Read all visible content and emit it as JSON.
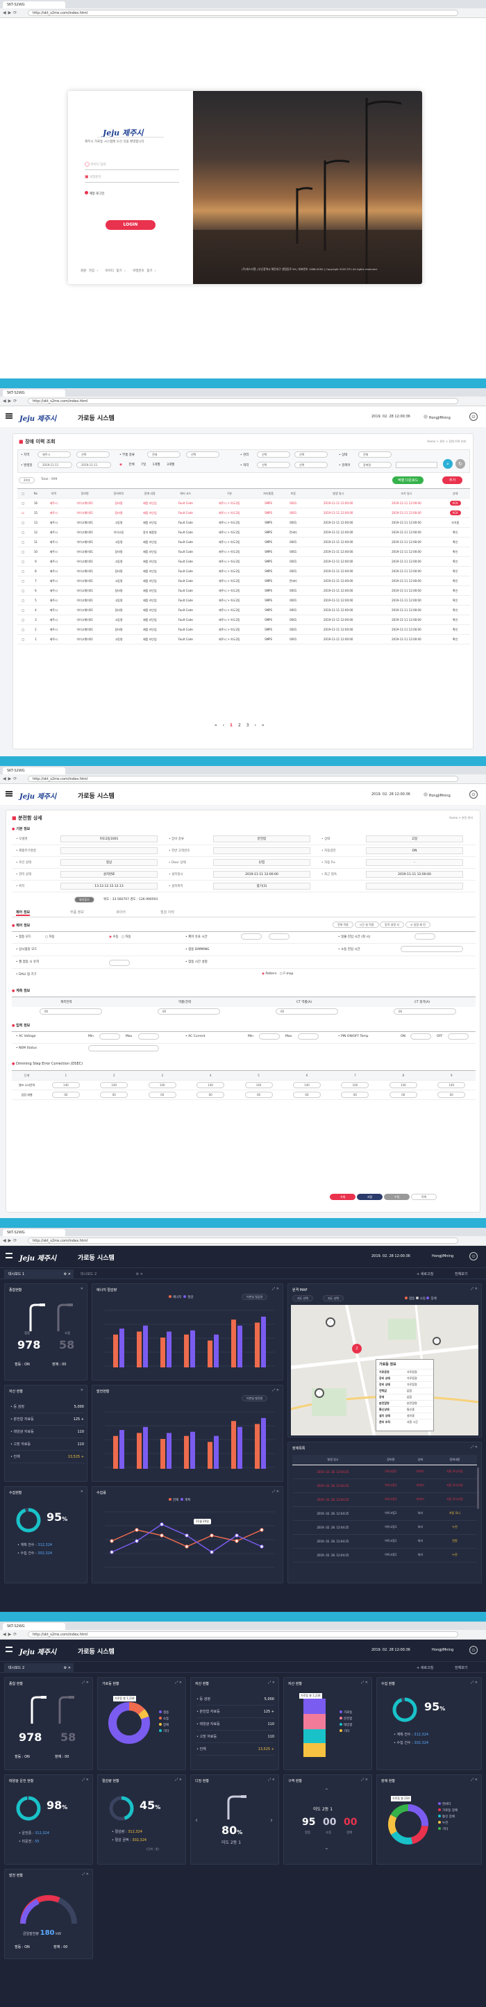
{
  "browser": {
    "tab_title": "SKT-S2WG",
    "url": "http://skt_s2ms.com/index.html"
  },
  "login": {
    "logo_text": "제주시",
    "welcome": "제주시 가로등 시스템에 오신 것을 환영합니다",
    "id_placeholder": "아이디 입력",
    "pw_placeholder": "비밀번호",
    "remember": "계정 로그인",
    "login_button": "LOGIN",
    "links": [
      "회원 가입 ›",
      "아이디 찾기 ›",
      "비밀번호 찾기 ›"
    ],
    "copyright": "(주)에스티엘 | 부산광역시 해운대구 센텀동로 99 | 대표번호 1588-0000 | Copyright 2020 STL All rights reserved."
  },
  "header": {
    "logo_text": "제주시",
    "system_name": "가로등 시스템",
    "datetime": "2019. 02. 28  12:00:36",
    "user": "HongjiMning"
  },
  "history": {
    "title": "장애 이력 조회",
    "breadcrumb": "Home  >  관리  >  장애 이력 조회",
    "filters": {
      "f1": "• 지역",
      "f1v": "제주시",
      "f2v": "선택",
      "f3": "• 부품 종류",
      "f3v": "전체",
      "f4": "• 관리",
      "f4v": "선택",
      "f5": "• 상태",
      "f5v": "전체",
      "f6": "• 발생일",
      "date1": "2019-11-11",
      "date2": "2019-11-11",
      "period": [
        "전체",
        "7일",
        "1개월",
        "3개월"
      ],
      "f7": "• 처리",
      "f7v": "선택",
      "f8": "• 검색어",
      "f8v": "장애명"
    },
    "total": "Total : 999",
    "view_label": "20개",
    "excel_button": "엑셀 다운로드",
    "add_button": "추가",
    "columns": [
      "No",
      "지역",
      "장비명",
      "장비위치",
      "장애 내용",
      "에러 코드",
      "구분",
      "처리물품",
      "보증",
      "발생 일시",
      "조치 일시",
      "상태"
    ],
    "rows": [
      [
        "16",
        "제주시",
        "아이고웨이01",
        "장비명",
        "제품 라인업",
        "Fault Code",
        "제주시 > 아도2동",
        "SMPS",
        "0001",
        "2019-11-11 12:00:00",
        "2019-11-11 12:00:00",
        "ACK"
      ],
      [
        "15",
        "제주시",
        "아이고웨이01",
        "장비명",
        "제품 라인업",
        "Fault Code",
        "제주시 > 아도2동",
        "SMPS",
        "0001",
        "2019-11-11 12:00:00",
        "2019-11-11 12:00:00",
        "ACK"
      ],
      [
        "13",
        "제주시",
        "아이고웨이01",
        "고등명",
        "제품 라인업",
        "Fault Code",
        "제주시 > 아도2동",
        "SMPS",
        "0001",
        "2019-11-11 12:00:00",
        "2019-11-11 12:00:00",
        "조치중"
      ],
      [
        "12",
        "제주시",
        "아이고웨이01",
        "아이고등",
        "장지 제품명",
        "Fault Code",
        "제주시 > 아도2동",
        "SMPS",
        "컨버터",
        "2019-11-11 12:00:00",
        "2019-11-11 12:00:00",
        "확인"
      ],
      [
        "11",
        "제주시",
        "아이고웨이01",
        "고등명",
        "제품 라인업",
        "Fault Code",
        "제주시 > 아도2동",
        "SMPS",
        "0001",
        "2019-11-11 12:00:00",
        "2019-11-11 12:00:00",
        "확인"
      ],
      [
        "10",
        "제주시",
        "아이고웨이01",
        "장비명",
        "제품 라인업",
        "Fault Code",
        "제주시 > 아도2동",
        "SMPS",
        "0001",
        "2019-11-11 12:00:00",
        "2019-11-11 12:00:00",
        "확인"
      ],
      [
        "9",
        "제주시",
        "아이고웨이01",
        "고등명",
        "제품 라인업",
        "Fault Code",
        "제주시 > 아도2동",
        "SMPS",
        "0001",
        "2019-11-11 12:00:00",
        "2019-11-11 12:00:00",
        "확인"
      ],
      [
        "8",
        "제주시",
        "아이고웨이01",
        "장비명",
        "제품 라인업",
        "Fault Code",
        "제주시 > 아도2동",
        "SMPS",
        "0001",
        "2019-11-11 12:00:00",
        "2019-11-11 12:00:00",
        "확인"
      ],
      [
        "7",
        "제주시",
        "아이고웨이01",
        "고등명",
        "제품 라인업",
        "Fault Code",
        "제주시 > 아도2동",
        "SMPS",
        "컨버터",
        "2019-11-11 12:00:00",
        "2019-11-11 12:00:00",
        "확인"
      ],
      [
        "6",
        "제주시",
        "아이고웨이01",
        "장비명",
        "제품 라인업",
        "Fault Code",
        "제주시 > 아도2동",
        "SMPS",
        "0001",
        "2019-11-11 12:00:00",
        "2019-11-11 12:00:00",
        "확인"
      ],
      [
        "5",
        "제주시",
        "아이고웨이01",
        "고등명",
        "제품 라인업",
        "Fault Code",
        "제주시 > 아도2동",
        "SMPS",
        "0001",
        "2019-11-11 12:00:00",
        "2019-11-11 12:00:00",
        "확인"
      ],
      [
        "4",
        "제주시",
        "아이고웨이01",
        "장비명",
        "제품 라인업",
        "Fault Code",
        "제주시 > 아도2동",
        "SMPS",
        "0001",
        "2019-11-11 12:00:00",
        "2019-11-11 12:00:00",
        "확인"
      ],
      [
        "3",
        "제주시",
        "아이고웨이01",
        "고등명",
        "제품 라인업",
        "Fault Code",
        "제주시 > 아도2동",
        "SMPS",
        "0001",
        "2019-11-11 12:00:00",
        "2019-11-11 12:00:00",
        "확인"
      ],
      [
        "2",
        "제주시",
        "아이고웨이01",
        "장비명",
        "제품 라인업",
        "Fault Code",
        "제주시 > 아도2동",
        "SMPS",
        "0001",
        "2019-11-11 12:00:00",
        "2019-11-11 12:00:00",
        "확인"
      ],
      [
        "1",
        "제주시",
        "아이고웨이01",
        "고등명",
        "제품 라인업",
        "Fault Code",
        "제주시 > 아도2동",
        "SMPS",
        "0001",
        "2019-11-11 12:00:00",
        "2019-11-11 12:00:00",
        "확인"
      ]
    ],
    "pagination": [
      "«",
      "‹",
      "1",
      "2",
      "3",
      "›",
      "»"
    ]
  },
  "detail": {
    "title": "분전함 상세",
    "breadcrumb": "Home  >  분전 관리",
    "s1": "기본 정보",
    "rows": [
      [
        "• 모델명",
        "이도2동1001",
        "• 장비 종류",
        "분전함",
        "• 상태",
        "고장"
      ],
      [
        "• 제품주기명칭",
        "",
        "• 전반 고객번호",
        "",
        "• 자동검진",
        "ON"
      ],
      [
        "• 조인 상태",
        "정상",
        "• Door 상태",
        "닫힘",
        "• 자동 Fix",
        "-"
      ],
      [
        "• 관리 상태",
        "설치완료",
        "• 설치일시",
        "2019-11-11 12:00:00",
        "• 최근 접속",
        "2019-11-11 12:00:00"
      ],
      [
        "• 위치",
        "13.12.12.12.12.13",
        "• 설치위치",
        "찾기(3)",
        "",
        ""
      ]
    ],
    "search_btn": "위치찾기",
    "coords": "위도 : 33.560707   경도 : 126.990593",
    "tabs": [
      "제어 정보",
      "부품 정보",
      "세이어",
      "점검 이력"
    ],
    "s2": "제어 정보",
    "ctrl_btns": [
      "전체 적용",
      "시간 설 적용",
      "동작 설정 지 ",
      "시 일정 제 된"
    ],
    "ctrl_labels": [
      "• 점등 모드",
      "• 제어 유효 시간",
      "• 상시점등 모드",
      "• 일몰 진입 시간 (최 시)",
      "• 월 점등 시 유지",
      "• 점등 DIMMING",
      "• DALI 점 기구",
      "• 점등 시간 설정",
      "• 소등 진입 시간"
    ],
    "mode_auto": "자동",
    "mode_manual": "수동",
    "pattern": "Pattern",
    "fmap": "F-map",
    "s3": "계측 정보",
    "meas_headers": [
      "계측전력",
      "역률(전력",
      "CT 역률(A)",
      "CT 정격(A)"
    ],
    "meas_vals": [
      "00",
      "00",
      "00",
      "00"
    ],
    "s4": "입력 정보",
    "input_labels": [
      "• AC Voltage",
      "Min",
      "Max",
      "• AC Current",
      "Min",
      "Max",
      "• PIN ON/OFF Temp",
      "ON",
      "OFF"
    ],
    "s4b": "• NEM Status",
    "dimming_title": "Dimming Step Error Correction (DSEC)",
    "dim_cols": [
      "단계",
      "1",
      "2",
      "3",
      "4",
      "5",
      "6",
      "7",
      "8",
      "9"
    ],
    "dim_rows": [
      [
        "램프 소비전력",
        "140",
        "140",
        "140",
        "140",
        "140",
        "140",
        "140",
        "140",
        "140"
      ],
      [
        "검정 레벨",
        "00",
        "00",
        "00",
        "00",
        "00",
        "00",
        "00",
        "00",
        "00"
      ]
    ],
    "buttons": [
      "삭제",
      "저장",
      "수정",
      "목록"
    ]
  },
  "dash1": {
    "tabs": [
      "대시보드 1",
      "대시보드 2"
    ],
    "new_tab": "+ 새로고침",
    "full": "전체보기",
    "p_total": {
      "title": "종합현황",
      "on": "점등",
      "off": "소등",
      "on_val": "978",
      "off_val": "58",
      "on_status": "점등 : ON",
      "off_status": "장애 : 00"
    },
    "p_energy": {
      "title": "에너지 절감량",
      "legend1": "에너지",
      "legend2": "절감",
      "sel": "이번달 절감량"
    },
    "p_map": {
      "title": "원격 MAP",
      "sel1": "지도 선택",
      "sel2": "지도 선택",
      "legend": [
        "점등",
        "소등",
        "장애"
      ],
      "popup_title": "가로등 정보",
      "popup_rows": [
        [
          "가로등명",
          "가로등명"
        ],
        [
          "장비 상태",
          "가로등명"
        ],
        [
          "장비 상태",
          "가로등명"
        ],
        [
          "전력값",
          "없음"
        ],
        [
          "장애",
          "없음"
        ],
        [
          "분전함명",
          "분전함명"
        ],
        [
          "통신상태",
          "통신중"
        ],
        [
          "설치 상태",
          "설치중"
        ],
        [
          "관리 조직",
          "사용 시간"
        ]
      ]
    },
    "p_asset": {
      "title": "자산 현황",
      "rows": [
        [
          "• 등 검정",
          "5,000",
          ""
        ],
        [
          "• 분전함 자료등",
          "125",
          "+"
        ],
        [
          "• 태양광 자료등",
          "110",
          ""
        ],
        [
          "• 고장 자료등",
          "110",
          ""
        ],
        [
          "• 전체",
          "13,525",
          "+"
        ]
      ]
    },
    "p_power": {
      "title": "발전현황",
      "sel": "이번달 발전량"
    },
    "p_wt": {
      "title": "수집현황",
      "pct": "95",
      "sub": "%",
      "r1l": "• 계획 전수 :",
      "r1v": "312,324",
      "r2l": "• 수집 건수 :",
      "r2v": "302,324"
    },
    "p_line": {
      "title": "수집률",
      "legend1": "현재",
      "legend2": "계획",
      "tip": "11월 20일"
    },
    "p_fault": {
      "title": "장애목록",
      "cols": [
        "발생 일시",
        "장비명",
        "상태",
        "장애내용"
      ],
      "rows": [
        [
          "2019. 02. 28. 12:04:25",
          "아이고등1",
          "미처리",
          "자동 모니터링"
        ],
        [
          "2019. 02. 28. 12:04:25",
          "아이고등1",
          "미처리",
          "자동 모니터링"
        ],
        [
          "2019. 02. 28. 12:04:25",
          "아이고등1",
          "미처리",
          "자동 모니터링"
        ],
        [
          "2019. 02. 28. 12:04:25",
          "아이고등1",
          "처리",
          "자동 모니"
        ],
        [
          "2019. 02. 28. 12:04:25",
          "아이고등1",
          "처리",
          "누전"
        ],
        [
          "2019. 02. 28. 12:04:25",
          "아이고등1",
          "처리",
          "전원"
        ],
        [
          "2019. 02. 28. 12:04:25",
          "아이고등1",
          "처리",
          "누전"
        ]
      ]
    }
  },
  "dash2": {
    "p_total": {
      "title": "종합 현황",
      "on_val": "978",
      "off_val": "58",
      "on_status": "점등 : ON",
      "off_status": "장애 : 00"
    },
    "p_lamp": {
      "title": "가로등 현황",
      "center": "가로등 총 1,234",
      "legend": [
        "점등",
        "소등",
        "장애",
        "기타"
      ]
    },
    "p_asset": {
      "title": "자산 현황",
      "rows": [
        [
          "• 등 검정",
          "5,000",
          ""
        ],
        [
          "• 분전함 자료등",
          "125",
          "+"
        ],
        [
          "• 태양광 자료등",
          "110",
          ""
        ],
        [
          "• 고장 자료등",
          "110",
          ""
        ],
        [
          "• 전체",
          "13,525",
          "+"
        ]
      ]
    },
    "p_asset2": {
      "title": "자산 현황",
      "center": "가로등 총 1,234",
      "legend": [
        "가로등",
        "분전함",
        "태양광",
        "기타"
      ]
    },
    "p_collect": {
      "title": "수집 현황",
      "pct": "95",
      "r1l": "• 계획 전수 :",
      "r1v": "312,324",
      "r2l": "• 수집 건수 :",
      "r2v": "302,324"
    },
    "p_solar": {
      "title": "태양광 운전 현황",
      "pct": "98",
      "r1l": "• 운전중 :",
      "r1v": "312,324",
      "r2l": "• 미운전 :",
      "r2v": "55"
    },
    "p_save": {
      "title": "절감량 현황",
      "pct": "45",
      "r1l": "• 절감량 :",
      "r1v": "312,324",
      "r2l": "• 절감 금액 :",
      "r2v": "302,324",
      "unit": "(단위 : 원)"
    },
    "p_dim": {
      "title": "디밍 현황",
      "pct": "80",
      "sub": "이도 2동 1"
    },
    "p_area": {
      "title": "구역 현황",
      "name": "이도 2동 1",
      "v1": "95",
      "v2": "00",
      "v3": "00",
      "l1": "점등",
      "l2": "소등",
      "l3": "장애"
    },
    "p_fault": {
      "title": "장애 현황",
      "center": "가로등 총 234",
      "legend": [
        "컨버터",
        "가로등 장애",
        "통신 장애",
        "누전",
        "기타"
      ]
    },
    "p_gen": {
      "title": "발전 현황",
      "label": "금일발전량",
      "val": "180",
      "unit": "kW",
      "on": "점등 : ON",
      "off": "장애 : 00"
    }
  },
  "colors": {
    "accent_red": "#e9324d",
    "brand_blue": "#1d3f91",
    "cyan_bar": "#2bb0d6",
    "dash_bg": "#1e2436",
    "bar_orange": "#ee6b4d",
    "bar_purple": "#7b5cf0"
  }
}
